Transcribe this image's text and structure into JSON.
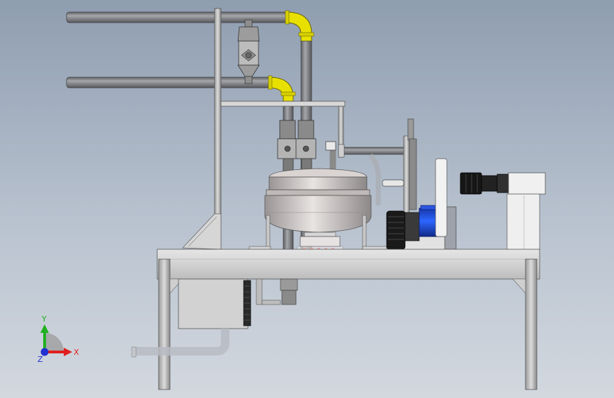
{
  "viewport": {
    "background_top": "#8f9db0",
    "background_bottom": "#d3d8df"
  },
  "colors": {
    "pipe": "#7a7c80",
    "pipe_highlight": "#b9bbbf",
    "elbow_yellow": "#e8e000",
    "steel": "#c9c9c9",
    "steel_dark": "#9a9a9a",
    "motor_blue": "#1f4fd8",
    "black_part": "#1a1a1a",
    "valve_grey": "#8e8e8e"
  },
  "triad": {
    "x_label": "X",
    "y_label": "Y",
    "z_label": "Z",
    "x_color": "#e02020",
    "y_color": "#20b020",
    "z_color": "#2030d0"
  }
}
